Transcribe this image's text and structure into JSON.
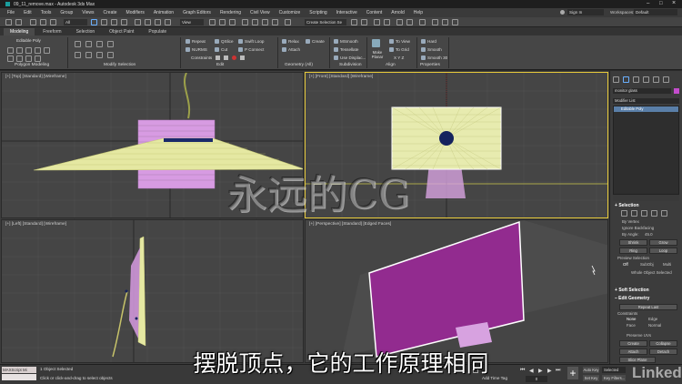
{
  "window": {
    "title": "09_11_remove.max - Autodesk 3ds Max",
    "sign_in": "Sign In",
    "workspaces_label": "Workspaces:",
    "workspace_value": "Default"
  },
  "menus": [
    "File",
    "Edit",
    "Tools",
    "Group",
    "Views",
    "Create",
    "Modifiers",
    "Animation",
    "Graph Editors",
    "Rendering",
    "Civil View",
    "Customize",
    "Scripting",
    "Interactive",
    "Content",
    "Arnold",
    "Help"
  ],
  "toolbar": {
    "filter_value": "All",
    "view_value": "View",
    "selection_set_placeholder": "Create Selection Se"
  },
  "ribbon_tabs": [
    "Modeling",
    "Freeform",
    "Selection",
    "Object Paint",
    "Populate"
  ],
  "ribbon": {
    "object_label": "Editable Poly",
    "groups": {
      "polygon_modeling": "Polygon Modeling",
      "modify_selection": "Modify Selection",
      "edit": "Edit",
      "geometry_all": "Geometry (All)",
      "subdivision": "Subdivision",
      "align": "Align",
      "properties": "Properties"
    },
    "edit_buttons": [
      "Repeat",
      "QSlice",
      "Swift Loop",
      "NURMS",
      "Cut",
      "P Connect",
      "Constraints"
    ],
    "geometry_buttons": [
      "Relax",
      "Create",
      "Attach"
    ],
    "subdivision_buttons": [
      "MSmooth",
      "Tessellate",
      "Use Displac..."
    ],
    "make_planar": "Make Planar",
    "align_buttons": [
      "To View",
      "To Grid",
      "X Y Z"
    ],
    "properties_buttons": [
      "Hard",
      "Smooth",
      "Smooth 30"
    ]
  },
  "viewports": {
    "top": "[+] [Top] [Standard] [Wireframe]",
    "front": "[+] [Front] [Standard] [Wireframe]",
    "left": "[+] [Left] [Standard] [Wireframe]",
    "perspective": "[+] [Perspective] [Standard] [Edged Faces]"
  },
  "command_panel": {
    "object_name": "monitor glass",
    "modifier_list": "Modifier List",
    "stack_item": "Editable Poly",
    "selection_head": "Selection",
    "by_vertex": "By Vertex",
    "ignore_backfacing": "Ignore Backfacing",
    "by_angle": "By Angle:",
    "by_angle_value": "45.0",
    "shrink": "Shrink",
    "grow": "Grow",
    "ring": "Ring",
    "loop": "Loop",
    "preview_selection": "Preview Selection",
    "preview_off": "Off",
    "preview_subobj": "SubObj",
    "preview_multi": "Multi",
    "whole_object_selected": "Whole Object Selected",
    "soft_selection": "Soft Selection",
    "edit_geometry": "Edit Geometry",
    "repeat_last": "Repeat Last",
    "constraints": "Constraints",
    "none": "None",
    "edge": "Edge",
    "face": "Face",
    "normal": "Normal",
    "preserve_uvs": "Preserve UVs",
    "create": "Create",
    "collapse": "Collapse",
    "attach": "Attach",
    "detach": "Detach",
    "slice_plane": "Slice Plane"
  },
  "status": {
    "maxscript": "MAXScript Mi",
    "objects_selected": "1 Object Selected",
    "prompt": "Click or click-and-drag to select objects",
    "add_time_tag": "Add Time Tag",
    "auto_key": "Auto Key",
    "set_key": "Set Key",
    "key_filters": "Key Filters...",
    "selected_label": "Selected",
    "frame": "0"
  },
  "subtitle": "摆脱顶点，它的工作原理相同",
  "watermark": "永远的CG",
  "brand": "Linked in"
}
